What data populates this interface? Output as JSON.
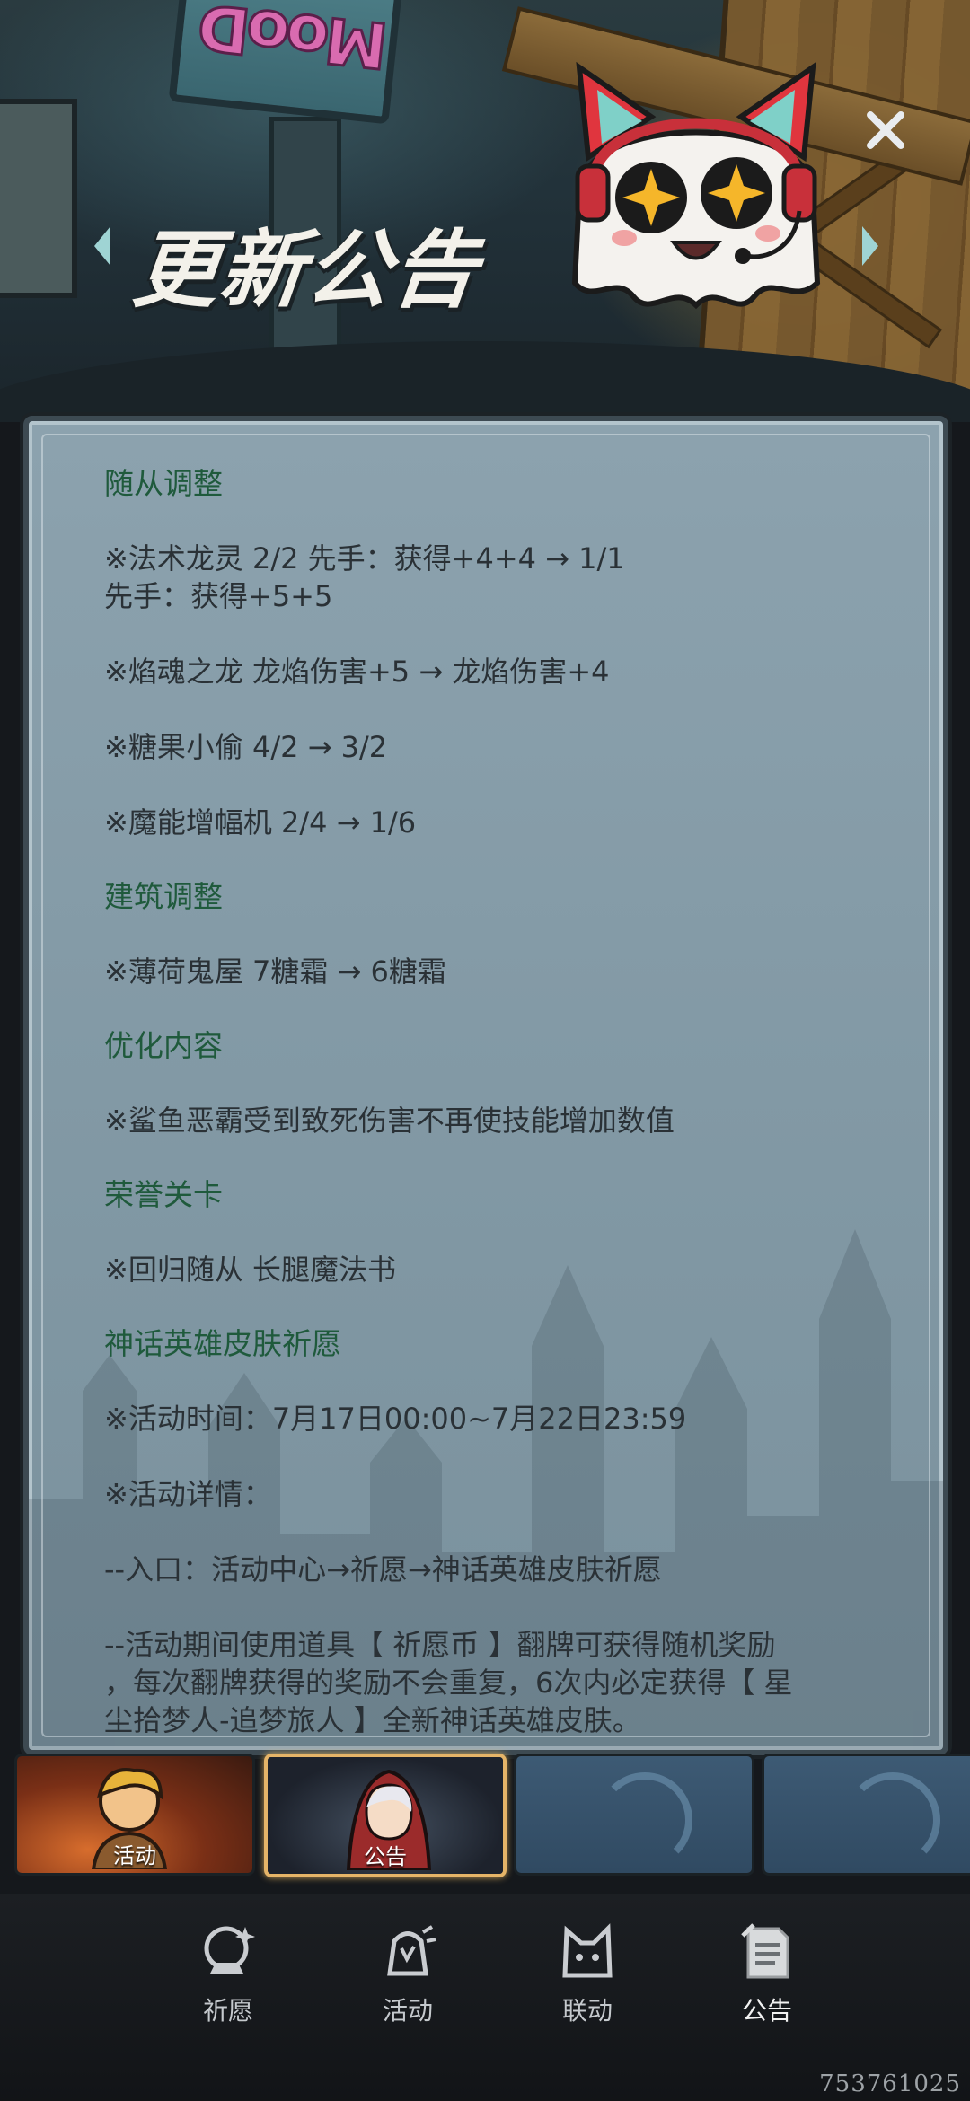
{
  "header": {
    "title": "更新公告",
    "sign_text": "MooD"
  },
  "content": {
    "sections": [
      {
        "title": "随从调整",
        "lines": [
          "※法术龙灵 2/2 先手：获得+4+4 → 1/1\n先手：获得+5+5",
          "※焰魂之龙 龙焰伤害+5 → 龙焰伤害+4",
          "※糖果小偷 4/2 → 3/2",
          "※魔能增幅机 2/4 → 1/6"
        ]
      },
      {
        "title": "建筑调整",
        "lines": [
          "※薄荷鬼屋 7糖霜 → 6糖霜"
        ]
      },
      {
        "title": "优化内容",
        "lines": [
          "※鲨鱼恶霸受到致死伤害不再使技能增加数值"
        ]
      },
      {
        "title": "荣誉关卡",
        "lines": [
          "※回归随从 长腿魔法书"
        ]
      },
      {
        "title": "神话英雄皮肤祈愿",
        "lines": [
          "※活动时间：7月17日00:00~7月22日23:59",
          "※活动详情：",
          "--入口：活动中心→祈愿→神话英雄皮肤祈愿",
          "--活动期间使用道具【 祈愿币 】翻牌可获得随机奖励\n，每次翻牌获得的奖励不会重复，6次内必定获得【 星\n尘拾梦人-追梦旅人 】全新神话英雄皮肤。"
        ]
      }
    ]
  },
  "tabs": [
    {
      "label": "活动",
      "active": false
    },
    {
      "label": "公告",
      "active": true
    },
    {
      "label": "",
      "active": false
    },
    {
      "label": "",
      "active": false
    }
  ],
  "nav": {
    "items": [
      {
        "label": "祈愿",
        "icon": "crystal-ball-icon"
      },
      {
        "label": "活动",
        "icon": "activity-bell-icon"
      },
      {
        "label": "联动",
        "icon": "cat-icon"
      },
      {
        "label": "公告",
        "icon": "notice-paper-icon",
        "active": true
      }
    ]
  },
  "watermark": "753761025",
  "colors": {
    "section_title": "#1f5a3c",
    "body_text": "#2a3136",
    "card_bg": "#8ca2ae",
    "active_tab_border": "#e5b468"
  }
}
